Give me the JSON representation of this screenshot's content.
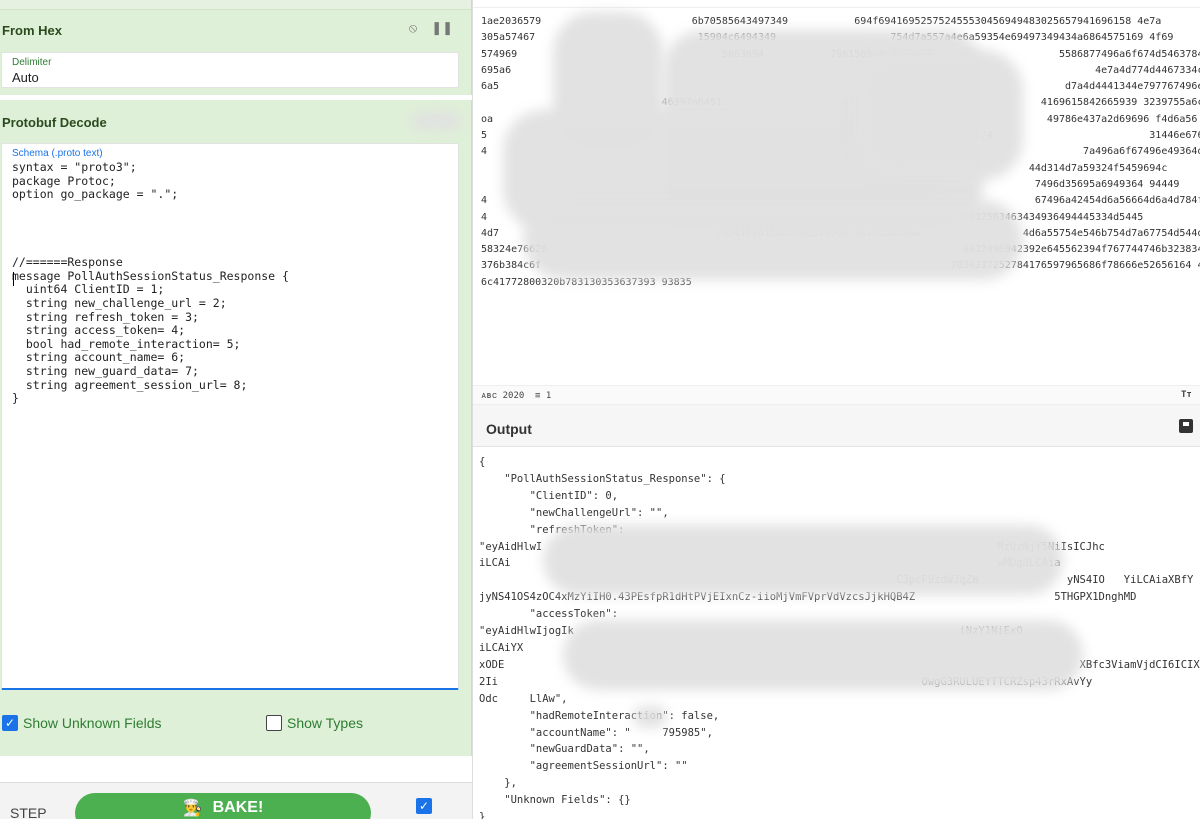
{
  "from_hex": {
    "title": "From Hex",
    "delimiter_label": "Delimiter",
    "delimiter_value": "Auto"
  },
  "protobuf": {
    "title": "Protobuf Decode",
    "schema_label": "Schema (.proto text)",
    "schema_text": "syntax = \"proto3\";\npackage Protoc;\noption go_package = \".\";\n\n\n\n\n//======Response\nmessage PollAuthSessionStatus_Response {\n  uint64 ClientID = 1;\n  string new_challenge_url = 2;\n  string refresh_token = 3;\n  string access_token= 4;\n  bool had_remote_interaction= 5;\n  string account_name= 6;\n  string new_guard_data= 7;\n  string agreement_session_url= 8;\n}",
    "show_unknown_label": "Show Unknown Fields",
    "show_types_label": "Show Types"
  },
  "controls": {
    "step_label": "STEP",
    "bake_label": "BAKE!"
  },
  "input": {
    "hex_text": "1ae2036579                         6b70585643497349           694f694169525752455530456949483025657941696158 4e7a\n305a57467                           15904c6494349                   754d7a557a4e6a59354e69497349434a6864575169 4f69\n574969                                  5863694           7961585a6c4969426                     5586877496a6f674d5463784d5459784d4553 30\n695a6                                                                                                 4e7a4d774d4467334c434169616e5270496a\n6a5                                                                                              d7a4d4441344e797767496e426c\n                              46397a6451                                                     4169615842665939 3239755a6c\noa                                                                                            49786e437a2d69696 f4d6a56\n5                                    8593637                               4e70597674                          31446e67684d446722fb0365\n4                                                                                                   7a496a6f67496e49364d4551\n                                                                                           44d314d7a59324f5459694c\n                                                                                            7496d35695a6949364 94449\n4                                                                                           67496a42454d6a56664d6a4d784f\n4                                                                               5832563463434936494445334d5445\n4d7                                    c434169615842666333566 9616d566a64                 4d6a55754e546b754d7a67754d544d3249\n58324e76626                                                                     4032496942392e645562394f767744746b323834 47\n376b384c6f                                                                    7034337252784176597965686f78666e52656164 44 4715 5734f64\n6c41772800320b783130353637393 93835",
    "status_length": "2020",
    "status_lines": "1"
  },
  "output": {
    "title": "Output",
    "text": "{\n    \"PollAuthSessionStatus_Response\": {\n        \"ClientID\": 0,\n        \"newChallengeUrl\": \"\",\n        \"refreshToken\":\n\"eyAidHlwI                                                                        MzUzNjY5NiIsICJhc\niLCAi                                                                             wMDg3LCAia\n                                                                  CJpcF9zdWJqZW              yNS4IO   YiLCAiaXBfY\njyNS41OS4zOC4xMzYiIH0.43PEsfpR1dHtPVjEIxnCz-iioMjVmFVprVdVzcsJjkHQB4Z                      5THGPX1DnghMD\n        \"accessToken\":\n\"eyAidHlwIjogIk                                                             iNzY1NiExO\niLCAiYX                                                                                         \nxODE                                                                                           XBfc3ViamVjdCI6ICIX\n2Ii                                                                   OwgG3RULUEYTTCRZsp43rRxAvYy\nOdc     LlAw\",\n        \"hadRemoteInteraction\": false,\n        \"accountName\": \"     795985\",\n        \"newGuardData\": \"\",\n        \"agreementSessionUrl\": \"\"\n    },\n    \"Unknown Fields\": {}\n}"
  }
}
